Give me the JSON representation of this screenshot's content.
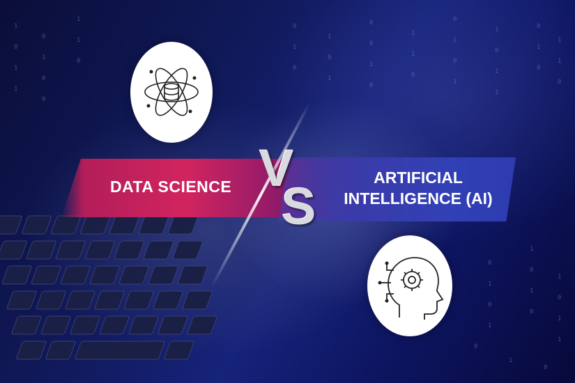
{
  "left_topic": {
    "label": "DATA SCIENCE",
    "icon": "atom-database-icon"
  },
  "right_topic": {
    "label_line1": "ARTIFICIAL",
    "label_line2": "INTELLIGENCE (AI)",
    "icon": "head-gear-circuit-icon"
  },
  "versus": {
    "v": "V",
    "s": "S"
  },
  "colors": {
    "background": "#111a5c",
    "left_band": "#d1245f",
    "right_band": "#3240b5",
    "circle": "#ffffff",
    "text": "#ffffff"
  }
}
